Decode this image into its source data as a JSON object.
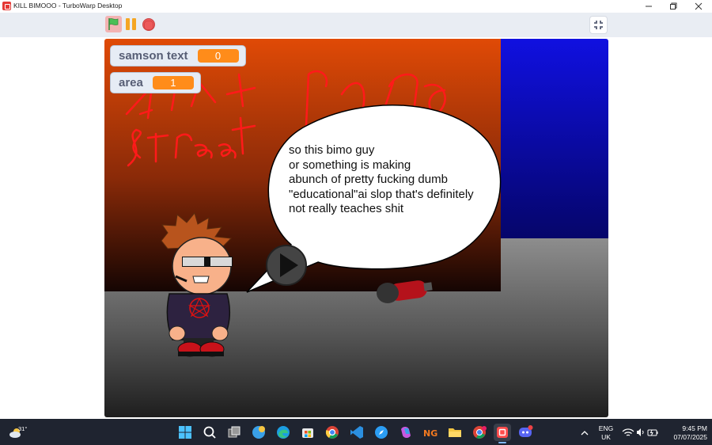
{
  "window": {
    "title": "KILL BIMOOO - TurboWarp Desktop"
  },
  "monitors": [
    {
      "label": "samson text",
      "value": "0"
    },
    {
      "label": "area",
      "value": "1"
    }
  ],
  "stage": {
    "speech_text": "so this bimo guy\nor something is making\nabunch of pretty fucking dumb\n\"educational\"ai slop that's definitely\nnot really teaches shit",
    "graffiti_text": "Street"
  },
  "taskbar": {
    "weather_temp": "31°",
    "lang_line1": "ENG",
    "lang_line2": "UK",
    "time": "9:45 PM",
    "date": "07/07/2025"
  },
  "colors": {
    "monitor_value": "#ff8c1a",
    "flag": "#4cbf56",
    "pause": "#f5a623",
    "stop": "#ec5959",
    "taskbar": "#1f2430"
  }
}
